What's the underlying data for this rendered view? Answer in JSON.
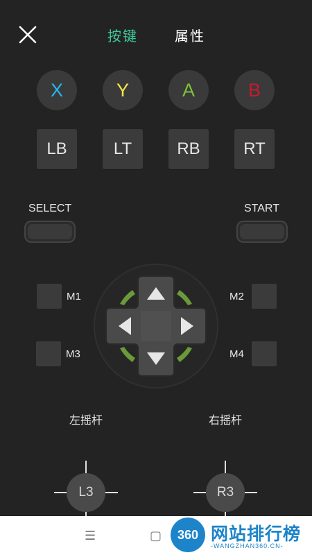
{
  "header": {
    "tabs": [
      {
        "label": "按键",
        "active": true
      },
      {
        "label": "属性",
        "active": false
      }
    ],
    "close_icon": "close-icon"
  },
  "face_buttons": [
    {
      "label": "X",
      "color": "#29b6f2"
    },
    {
      "label": "Y",
      "color": "#f4e64a"
    },
    {
      "label": "A",
      "color": "#7cc13b"
    },
    {
      "label": "B",
      "color": "#c8192e"
    }
  ],
  "shoulder_buttons": [
    "LB",
    "LT",
    "RB",
    "RT"
  ],
  "select_label": "SELECT",
  "start_label": "START",
  "macro_buttons": [
    "M1",
    "M2",
    "M3",
    "M4"
  ],
  "dpad": {
    "icons": [
      "arrow-up-icon",
      "arrow-down-icon",
      "arrow-left-icon",
      "arrow-right-icon"
    ],
    "accent_color": "#6a9a3a"
  },
  "sticks": {
    "left_label": "左摇杆",
    "right_label": "右摇杆",
    "left_button": "L3",
    "right_button": "R3"
  },
  "watermark": {
    "badge": "360",
    "name": "网站排行榜",
    "sub": "-WANGZHAN360.CN-"
  },
  "nav_icons": [
    "menu-icon",
    "home-square-icon"
  ]
}
